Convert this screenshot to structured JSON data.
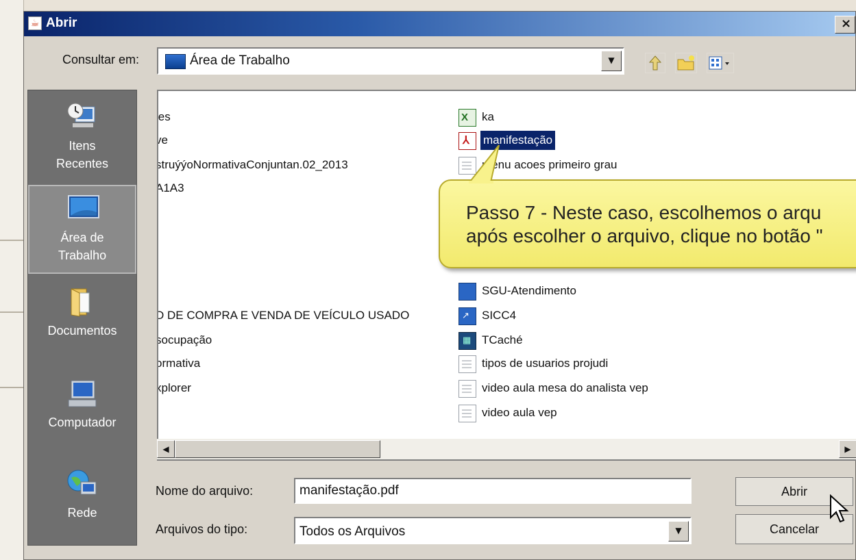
{
  "dialog": {
    "title": "Abrir",
    "close_glyph": "×"
  },
  "lookin": {
    "label": "Consultar em:",
    "value": "Área de Trabalho",
    "toolbar_icons": [
      "up-folder-icon",
      "new-folder-icon",
      "view-menu-icon"
    ]
  },
  "places": [
    {
      "line1": "Itens",
      "line2": "Recentes",
      "icon": "recent-items-icon",
      "selected": false
    },
    {
      "line1": "Área de",
      "line2": "Trabalho",
      "icon": "desktop-icon",
      "selected": true
    },
    {
      "line1": "Documentos",
      "line2": "",
      "icon": "documents-icon",
      "selected": false
    },
    {
      "line1": "Computador",
      "line2": "",
      "icon": "computer-icon",
      "selected": false
    },
    {
      "line1": "Rede",
      "line2": "",
      "icon": "network-icon",
      "selected": false
    }
  ],
  "files_left": [
    "les",
    "ve",
    "struýýoNormativaConjuntan.02_2013",
    "A1A3",
    "D DE COMPRA E VENDA DE VEÍCULO USADO",
    "socupação",
    "ormativa",
    "xplorer"
  ],
  "files_right": [
    {
      "name": "ka",
      "icon": "excel-icon"
    },
    {
      "name": "manifestação",
      "icon": "pdf-icon",
      "selected": true
    },
    {
      "name": "menu acoes primeiro grau",
      "icon": "text-file-icon"
    },
    {
      "name": "SGU-Atendimento",
      "icon": "shortcut-icon"
    },
    {
      "name": "SICC4",
      "icon": "shortcut-icon"
    },
    {
      "name": "TCaché",
      "icon": "app-icon"
    },
    {
      "name": "tipos de usuarios projudi",
      "icon": "text-file-icon"
    },
    {
      "name": "video aula mesa do analista vep",
      "icon": "text-file-icon"
    },
    {
      "name": "video aula vep",
      "icon": "text-file-icon"
    }
  ],
  "filename": {
    "label": "Nome do arquivo:",
    "value": "manifestação.pdf"
  },
  "filetype": {
    "label": "Arquivos do tipo:",
    "value": "Todos os Arquivos"
  },
  "buttons": {
    "open": "Abrir",
    "cancel": "Cancelar"
  },
  "callout": {
    "line1": "Passo 7 - Neste caso, escolhemos o arqu",
    "line2": "após escolher o arquivo, clique no botão \""
  },
  "colors": {
    "title_start": "#0a246a",
    "title_end": "#a6caf0",
    "selection": "#0a246a",
    "callout": "#f2ea6d"
  }
}
